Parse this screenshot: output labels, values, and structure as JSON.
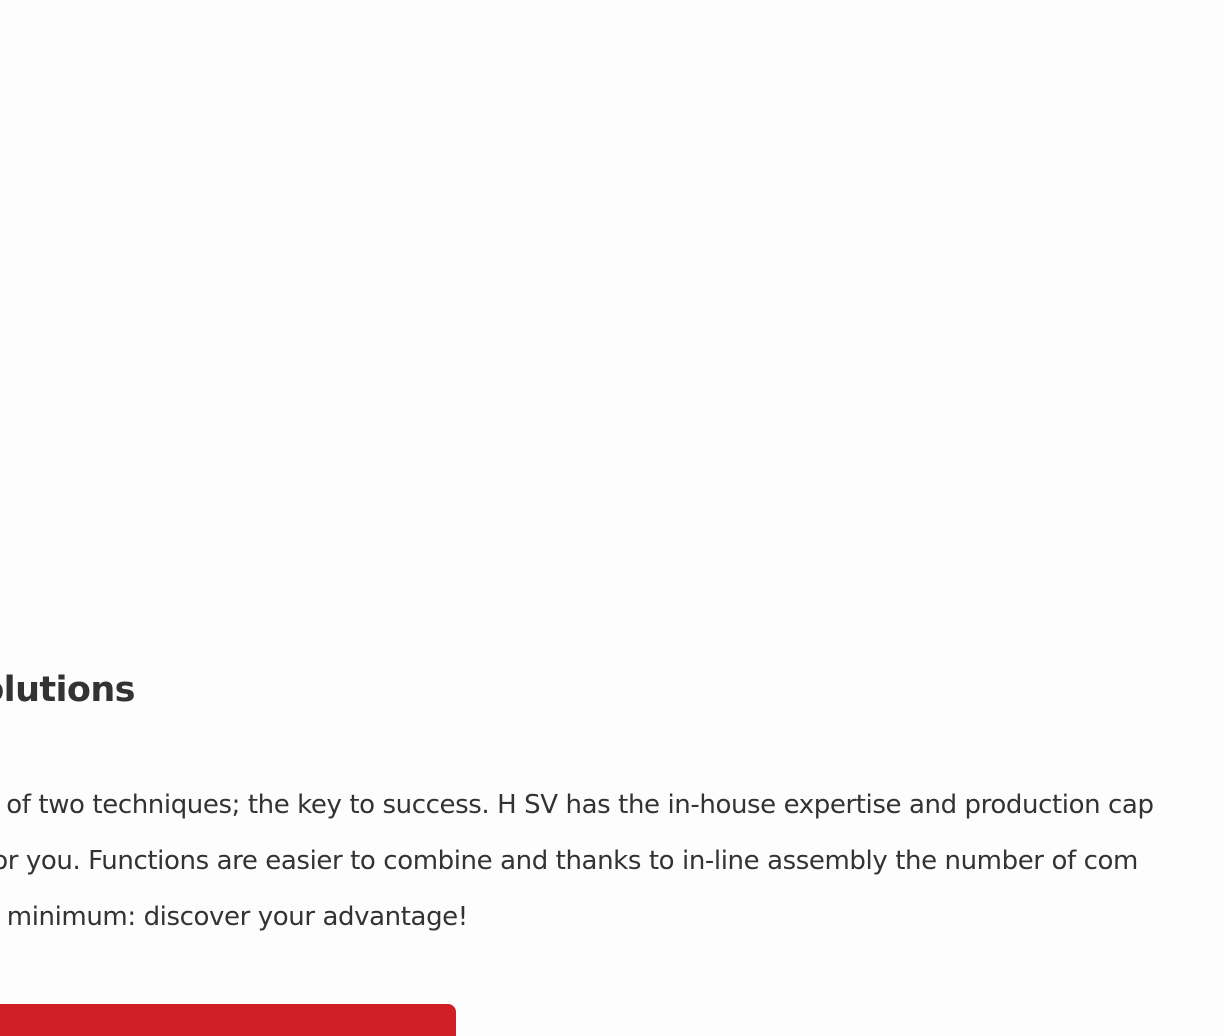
{
  "section": {
    "title": "solutions",
    "body_lines": [
      "ion of two techniques; the key to success. H SV has the in-house expertise and production cap",
      "e for you.  Functions are easier to combine and thanks to in-line assembly the number of com",
      "o a minimum: discover your advantage!"
    ]
  },
  "cta": {
    "label": "",
    "color": "#d01f27"
  },
  "colors": {
    "background": "#fdfdfd",
    "text": "#333333"
  }
}
